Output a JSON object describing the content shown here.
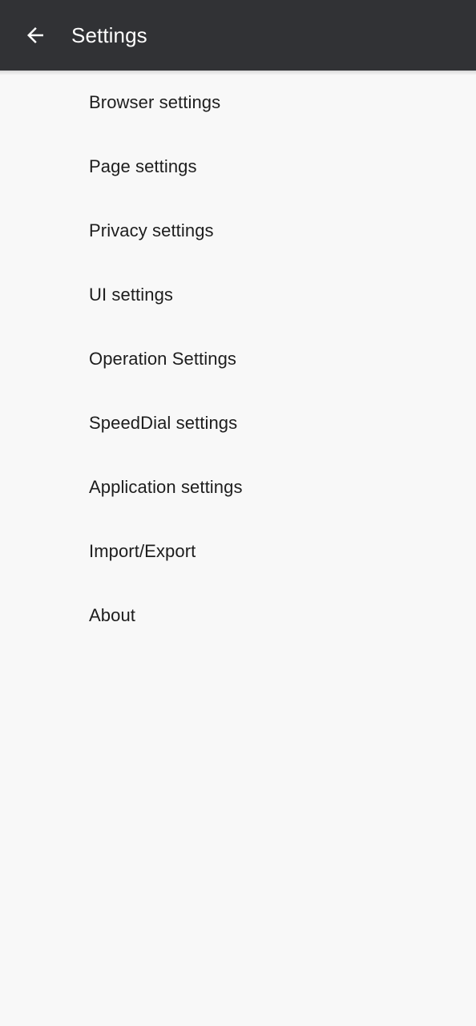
{
  "window": {
    "title": "Settings",
    "background_color": "#f8f8f8"
  },
  "appbar": {
    "title": "Settings",
    "background_color": "#313235",
    "title_color": "#ffffff",
    "back_icon": "arrow-left-icon"
  },
  "settings_list": {
    "items": [
      {
        "label": "Browser settings"
      },
      {
        "label": "Page settings"
      },
      {
        "label": "Privacy settings"
      },
      {
        "label": "UI settings"
      },
      {
        "label": "Operation Settings"
      },
      {
        "label": "SpeedDial settings"
      },
      {
        "label": "Application settings"
      },
      {
        "label": "Import/Export"
      },
      {
        "label": "About"
      }
    ]
  }
}
